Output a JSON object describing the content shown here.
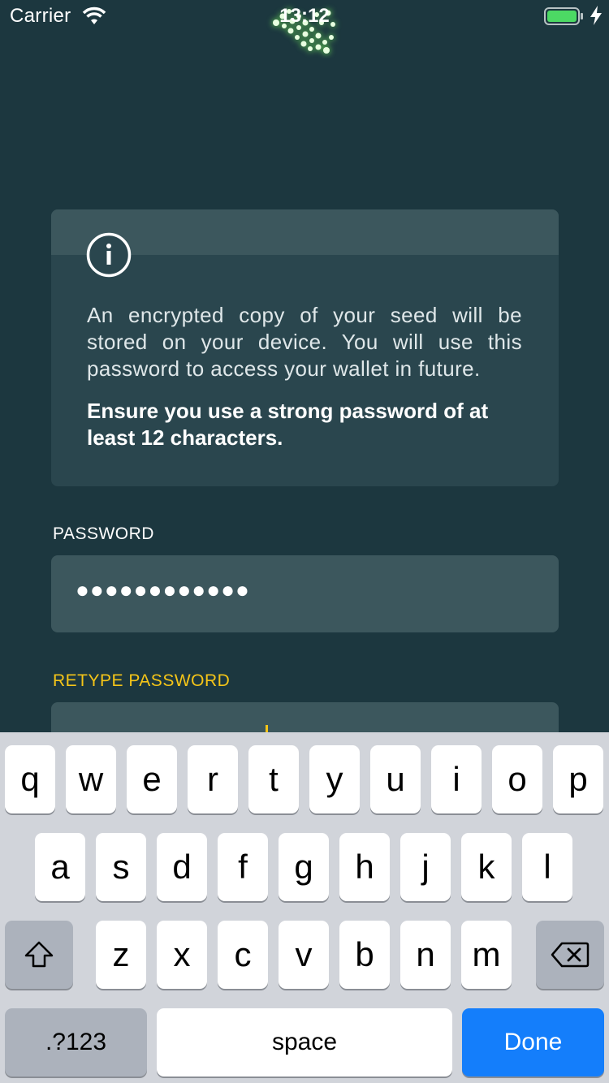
{
  "status_bar": {
    "carrier": "Carrier",
    "time": "13:12",
    "battery_color": "#4cd964"
  },
  "info_card": {
    "icon": "info-icon",
    "text": "An encrypted copy of your seed will be stored on your device. You will use this password to access your wallet in future.",
    "strong_text": "Ensure you use a strong password of at least 12 characters."
  },
  "password": {
    "label": "PASSWORD",
    "value": "●●●●●●●●●●●●"
  },
  "retype_password": {
    "label": "RETYPE PASSWORD",
    "value": ""
  },
  "keyboard": {
    "row1": [
      "q",
      "w",
      "e",
      "r",
      "t",
      "y",
      "u",
      "i",
      "o",
      "p"
    ],
    "row2": [
      "a",
      "s",
      "d",
      "f",
      "g",
      "h",
      "j",
      "k",
      "l"
    ],
    "row3": [
      "z",
      "x",
      "c",
      "v",
      "b",
      "n",
      "m"
    ],
    "numbers_label": ".?123",
    "space_label": "space",
    "done_label": "Done"
  },
  "colors": {
    "background": "#1c373f",
    "card": "#2a464e",
    "field": "#3c575d",
    "accent": "#f5c518",
    "done_button": "#147efb"
  }
}
